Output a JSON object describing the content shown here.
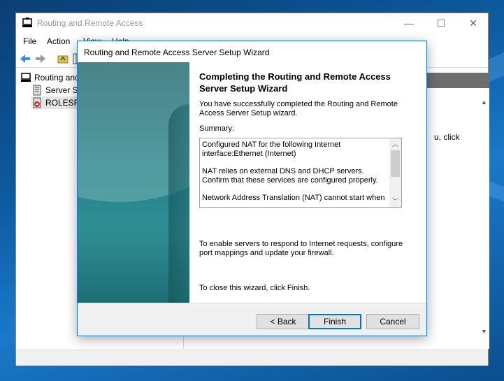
{
  "main_window": {
    "title": "Routing and Remote Access",
    "controls": [
      "—",
      "☐",
      "✕"
    ],
    "menu": [
      "File",
      "Action",
      "View",
      "Help"
    ],
    "tree": [
      {
        "label": "Routing and",
        "icon": "server-tree-icon"
      },
      {
        "label": "Server St",
        "icon": "server-status-icon"
      },
      {
        "label": "ROLESRV",
        "icon": "server-down-icon"
      }
    ],
    "right_pane_text": "u, click"
  },
  "wizard": {
    "title": "Routing and Remote Access Server Setup Wizard",
    "heading": "Completing the Routing and Remote Access Server Setup Wizard",
    "success_text": "You have successfully completed the Routing and Remote Access Server Setup wizard.",
    "summary_label": "Summary:",
    "summary_lines": [
      "Configured NAT for the following Internet interface:Ethernet (Internet)",
      "NAT relies on external DNS and DHCP servers. Confirm that these services are configured properly.",
      "Network Address Translation (NAT) cannot start when"
    ],
    "enable_text": "To enable servers to respond to Internet requests, configure port mappings and update your firewall.",
    "close_text": "To close this wizard, click Finish.",
    "buttons": {
      "back": "< Back",
      "finish": "Finish",
      "cancel": "Cancel"
    }
  }
}
